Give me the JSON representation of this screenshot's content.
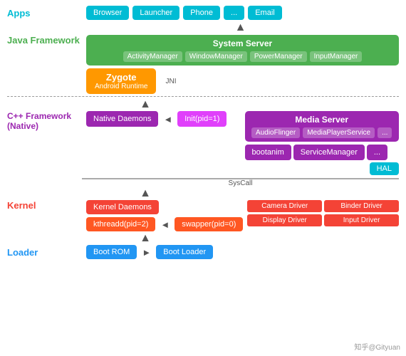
{
  "layers": {
    "apps": {
      "label": "Apps",
      "color": "#00bcd4",
      "items": [
        "Browser",
        "Launcher",
        "Phone",
        "...",
        "Email"
      ]
    },
    "java_framework": {
      "label": "Java Framework",
      "color": "#4caf50",
      "system_server": {
        "title": "System Server",
        "items": [
          "ActivityManager",
          "WindowManager",
          "PowerManager",
          "InputManager"
        ]
      },
      "zygote": {
        "title": "Zygote",
        "subtitle": "Android Runtime"
      },
      "jni": "JNI"
    },
    "cpp_framework": {
      "label": "C++ Framework\n(Native)",
      "color": "#9c27b0",
      "media_server": {
        "title": "Media Server",
        "items": [
          "AudioFlinger",
          "MediaPlayerService",
          "..."
        ]
      },
      "native_daemons": "Native Daemons",
      "init": "Init(pid=1)",
      "boot_anim": "bootanim",
      "service_manager": "ServiceManager",
      "dots": "...",
      "hal": "HAL"
    },
    "kernel": {
      "label": "Kernel",
      "color": "#f44336",
      "kernel_daemons": "Kernel Daemons",
      "kthreadd": "kthreadd(pid=2)",
      "swapper": "swapper(pid=0)",
      "syscall": "SysCall",
      "drivers": [
        "Camera Driver",
        "Binder Driver",
        "Display Driver",
        "Input Driver"
      ]
    },
    "loader": {
      "label": "Loader",
      "color": "#2196f3",
      "items": [
        "Boot ROM",
        "Boot Loader"
      ]
    }
  },
  "watermark": "知乎@Gityuan"
}
